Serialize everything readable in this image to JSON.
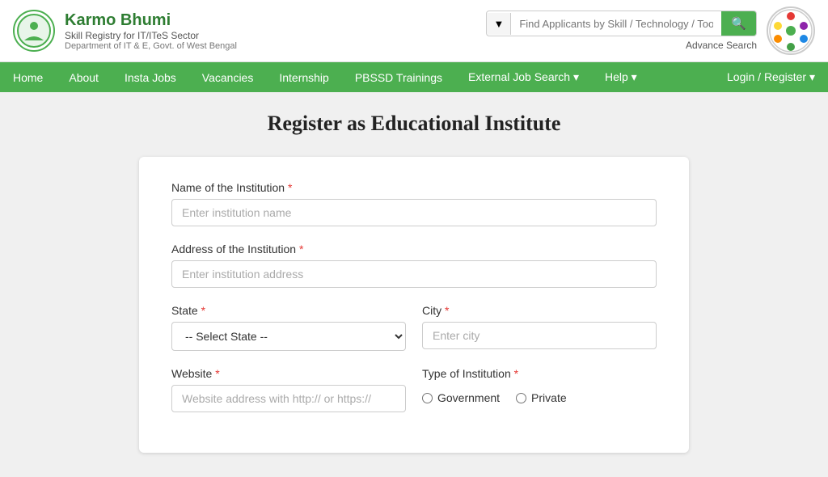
{
  "header": {
    "brand_name": "Karmo Bhumi",
    "brand_sub": "Skill Registry for IT/ITeS Sector",
    "brand_dept": "Department of IT & E, Govt. of West Bengal",
    "search_placeholder": "Find Applicants by Skill / Technology / Tool",
    "search_dropdown_label": "▼",
    "search_button_icon": "🔍",
    "advance_search_label": "Advance Search"
  },
  "navbar": {
    "items": [
      {
        "label": "Home",
        "id": "home"
      },
      {
        "label": "About",
        "id": "about"
      },
      {
        "label": "Insta Jobs",
        "id": "insta-jobs"
      },
      {
        "label": "Vacancies",
        "id": "vacancies"
      },
      {
        "label": "Internship",
        "id": "internship"
      },
      {
        "label": "PBSSD Trainings",
        "id": "pbssd"
      },
      {
        "label": "External Job Search ▾",
        "id": "ext-job"
      },
      {
        "label": "Help ▾",
        "id": "help"
      }
    ],
    "login_label": "Login / Register ▾"
  },
  "page": {
    "title": "Register as Educational Institute"
  },
  "form": {
    "institution_name_label": "Name of the Institution",
    "institution_name_placeholder": "Enter institution name",
    "address_label": "Address of the Institution",
    "address_placeholder": "Enter institution address",
    "state_label": "State",
    "state_placeholder": "-- Select State --",
    "city_label": "City",
    "city_placeholder": "Enter city",
    "website_label": "Website",
    "website_placeholder": "Website address with http:// or https://",
    "institution_type_label": "Type of Institution",
    "institution_type_options": [
      {
        "label": "Government",
        "value": "government"
      },
      {
        "label": "Private",
        "value": "private"
      }
    ],
    "required_marker": "*"
  }
}
